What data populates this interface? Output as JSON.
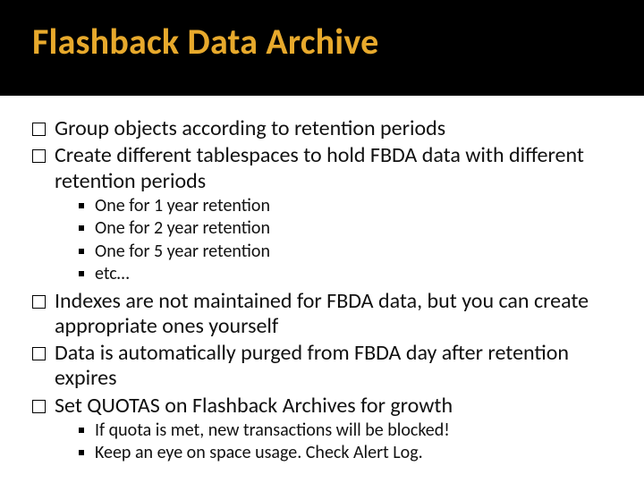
{
  "title": "Flashback Data Archive",
  "bullets": {
    "b1": "Group objects according to retention periods",
    "b2": "Create different tablespaces to hold FBDA data with different retention periods",
    "b2s": {
      "s1": "One for 1 year retention",
      "s2": "One for 2 year retention",
      "s3": "One for 5 year retention",
      "s4": "etc…"
    },
    "b3": "Indexes are not maintained for FBDA data, but you can create appropriate ones yourself",
    "b4": "Data is automatically purged from FBDA day after retention expires",
    "b5": "Set QUOTAS on Flashback Archives for growth",
    "b5s": {
      "s1": "If quota is met, new transactions will be blocked!",
      "s2": "Keep an eye on space usage.  Check Alert Log."
    }
  }
}
